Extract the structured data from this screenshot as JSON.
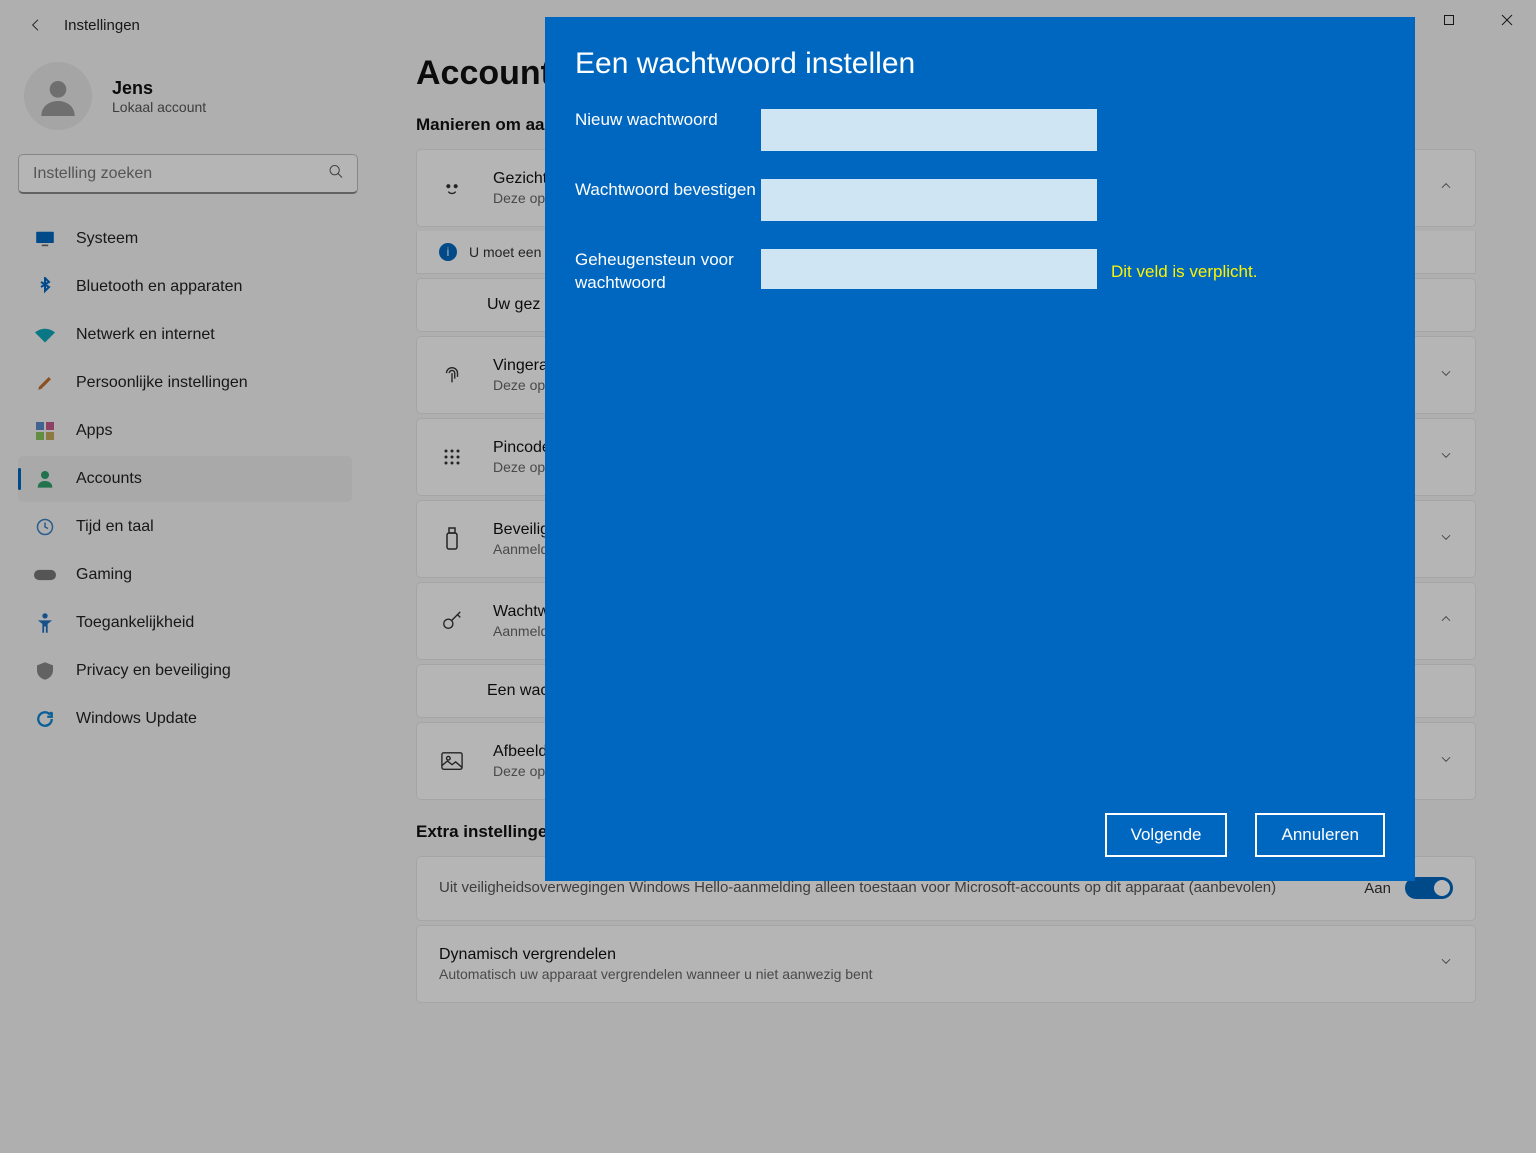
{
  "window": {
    "title": "Instellingen"
  },
  "user": {
    "name": "Jens",
    "subtitle": "Lokaal account"
  },
  "search": {
    "placeholder": "Instelling zoeken"
  },
  "nav": [
    {
      "label": "Systeem",
      "icon": "monitor"
    },
    {
      "label": "Bluetooth en apparaten",
      "icon": "bluetooth"
    },
    {
      "label": "Netwerk en internet",
      "icon": "wifi"
    },
    {
      "label": "Persoonlijke instellingen",
      "icon": "brush"
    },
    {
      "label": "Apps",
      "icon": "apps"
    },
    {
      "label": "Accounts",
      "icon": "person",
      "selected": true
    },
    {
      "label": "Tijd en taal",
      "icon": "clock"
    },
    {
      "label": "Gaming",
      "icon": "gamepad"
    },
    {
      "label": "Toegankelijkheid",
      "icon": "accessibility"
    },
    {
      "label": "Privacy en beveiliging",
      "icon": "shield"
    },
    {
      "label": "Windows Update",
      "icon": "update"
    }
  ],
  "page": {
    "title": "Accounts",
    "section1": "Manieren om aan te melden",
    "info_banner": "U moet een",
    "sub_card1": "Uw gez",
    "section2": "Extra instellingen",
    "toggle_text": "Uit veiligheidsoverwegingen Windows Hello-aanmelding alleen toestaan voor Microsoft-accounts op dit apparaat (aanbevolen)",
    "toggle_state": "Aan",
    "dynlock_title": "Dynamisch vergrendelen",
    "dynlock_sub": "Automatisch uw apparaat vergrendelen wanneer u niet aanwezig bent"
  },
  "cards": [
    {
      "title": "Gezichtsherkenning",
      "sub": "Deze optie",
      "icon": "face",
      "chev": "up"
    },
    {
      "title": "Vingerafdruk",
      "sub": "Deze optie",
      "icon": "fingerprint",
      "chev": "down"
    },
    {
      "title": "Pincode",
      "sub": "Deze optie",
      "icon": "pin",
      "chev": "down"
    },
    {
      "title": "Beveiligingssleutel",
      "sub": "Aanmelden",
      "icon": "usb",
      "chev": "down"
    },
    {
      "title": "Wachtwoord",
      "sub": "Aanmelden",
      "icon": "key",
      "chev": "up"
    },
    {
      "title": "Afbeelding",
      "sub": "Deze optie",
      "icon": "picture",
      "chev": "down"
    }
  ],
  "sub_card_wacht": "Een wachtwoord",
  "dialog": {
    "title": "Een wachtwoord instellen",
    "label_new": "Nieuw wachtwoord",
    "label_confirm": "Wachtwoord bevestigen",
    "label_hint": "Geheugensteun voor wachtwoord",
    "validation": "Dit veld is verplicht.",
    "btn_next": "Volgende",
    "btn_cancel": "Annuleren"
  }
}
